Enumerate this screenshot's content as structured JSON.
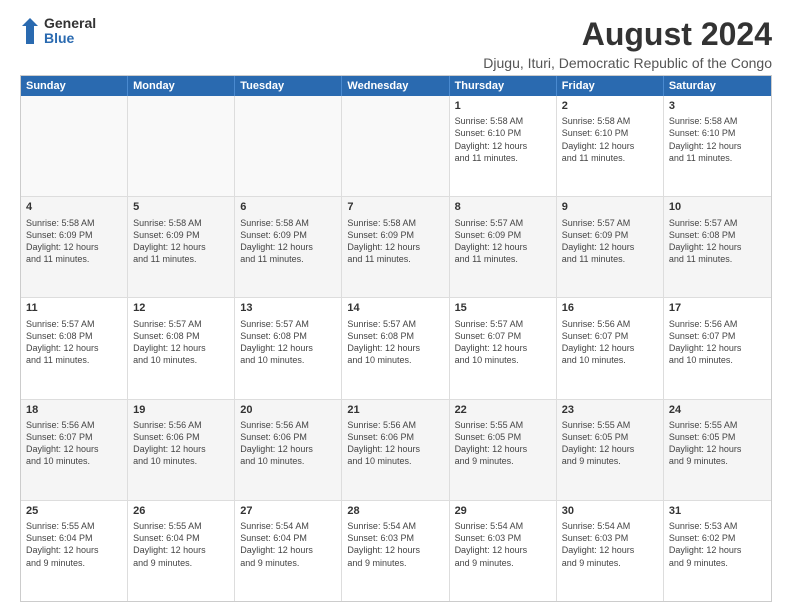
{
  "logo": {
    "general": "General",
    "blue": "Blue"
  },
  "title": "August 2024",
  "subtitle": "Djugu, Ituri, Democratic Republic of the Congo",
  "weekdays": [
    "Sunday",
    "Monday",
    "Tuesday",
    "Wednesday",
    "Thursday",
    "Friday",
    "Saturday"
  ],
  "weeks": [
    [
      {
        "day": "",
        "info": ""
      },
      {
        "day": "",
        "info": ""
      },
      {
        "day": "",
        "info": ""
      },
      {
        "day": "",
        "info": ""
      },
      {
        "day": "1",
        "info": "Sunrise: 5:58 AM\nSunset: 6:10 PM\nDaylight: 12 hours\nand 11 minutes."
      },
      {
        "day": "2",
        "info": "Sunrise: 5:58 AM\nSunset: 6:10 PM\nDaylight: 12 hours\nand 11 minutes."
      },
      {
        "day": "3",
        "info": "Sunrise: 5:58 AM\nSunset: 6:10 PM\nDaylight: 12 hours\nand 11 minutes."
      }
    ],
    [
      {
        "day": "4",
        "info": "Sunrise: 5:58 AM\nSunset: 6:09 PM\nDaylight: 12 hours\nand 11 minutes."
      },
      {
        "day": "5",
        "info": "Sunrise: 5:58 AM\nSunset: 6:09 PM\nDaylight: 12 hours\nand 11 minutes."
      },
      {
        "day": "6",
        "info": "Sunrise: 5:58 AM\nSunset: 6:09 PM\nDaylight: 12 hours\nand 11 minutes."
      },
      {
        "day": "7",
        "info": "Sunrise: 5:58 AM\nSunset: 6:09 PM\nDaylight: 12 hours\nand 11 minutes."
      },
      {
        "day": "8",
        "info": "Sunrise: 5:57 AM\nSunset: 6:09 PM\nDaylight: 12 hours\nand 11 minutes."
      },
      {
        "day": "9",
        "info": "Sunrise: 5:57 AM\nSunset: 6:09 PM\nDaylight: 12 hours\nand 11 minutes."
      },
      {
        "day": "10",
        "info": "Sunrise: 5:57 AM\nSunset: 6:08 PM\nDaylight: 12 hours\nand 11 minutes."
      }
    ],
    [
      {
        "day": "11",
        "info": "Sunrise: 5:57 AM\nSunset: 6:08 PM\nDaylight: 12 hours\nand 11 minutes."
      },
      {
        "day": "12",
        "info": "Sunrise: 5:57 AM\nSunset: 6:08 PM\nDaylight: 12 hours\nand 10 minutes."
      },
      {
        "day": "13",
        "info": "Sunrise: 5:57 AM\nSunset: 6:08 PM\nDaylight: 12 hours\nand 10 minutes."
      },
      {
        "day": "14",
        "info": "Sunrise: 5:57 AM\nSunset: 6:08 PM\nDaylight: 12 hours\nand 10 minutes."
      },
      {
        "day": "15",
        "info": "Sunrise: 5:57 AM\nSunset: 6:07 PM\nDaylight: 12 hours\nand 10 minutes."
      },
      {
        "day": "16",
        "info": "Sunrise: 5:56 AM\nSunset: 6:07 PM\nDaylight: 12 hours\nand 10 minutes."
      },
      {
        "day": "17",
        "info": "Sunrise: 5:56 AM\nSunset: 6:07 PM\nDaylight: 12 hours\nand 10 minutes."
      }
    ],
    [
      {
        "day": "18",
        "info": "Sunrise: 5:56 AM\nSunset: 6:07 PM\nDaylight: 12 hours\nand 10 minutes."
      },
      {
        "day": "19",
        "info": "Sunrise: 5:56 AM\nSunset: 6:06 PM\nDaylight: 12 hours\nand 10 minutes."
      },
      {
        "day": "20",
        "info": "Sunrise: 5:56 AM\nSunset: 6:06 PM\nDaylight: 12 hours\nand 10 minutes."
      },
      {
        "day": "21",
        "info": "Sunrise: 5:56 AM\nSunset: 6:06 PM\nDaylight: 12 hours\nand 10 minutes."
      },
      {
        "day": "22",
        "info": "Sunrise: 5:55 AM\nSunset: 6:05 PM\nDaylight: 12 hours\nand 9 minutes."
      },
      {
        "day": "23",
        "info": "Sunrise: 5:55 AM\nSunset: 6:05 PM\nDaylight: 12 hours\nand 9 minutes."
      },
      {
        "day": "24",
        "info": "Sunrise: 5:55 AM\nSunset: 6:05 PM\nDaylight: 12 hours\nand 9 minutes."
      }
    ],
    [
      {
        "day": "25",
        "info": "Sunrise: 5:55 AM\nSunset: 6:04 PM\nDaylight: 12 hours\nand 9 minutes."
      },
      {
        "day": "26",
        "info": "Sunrise: 5:55 AM\nSunset: 6:04 PM\nDaylight: 12 hours\nand 9 minutes."
      },
      {
        "day": "27",
        "info": "Sunrise: 5:54 AM\nSunset: 6:04 PM\nDaylight: 12 hours\nand 9 minutes."
      },
      {
        "day": "28",
        "info": "Sunrise: 5:54 AM\nSunset: 6:03 PM\nDaylight: 12 hours\nand 9 minutes."
      },
      {
        "day": "29",
        "info": "Sunrise: 5:54 AM\nSunset: 6:03 PM\nDaylight: 12 hours\nand 9 minutes."
      },
      {
        "day": "30",
        "info": "Sunrise: 5:54 AM\nSunset: 6:03 PM\nDaylight: 12 hours\nand 9 minutes."
      },
      {
        "day": "31",
        "info": "Sunrise: 5:53 AM\nSunset: 6:02 PM\nDaylight: 12 hours\nand 9 minutes."
      }
    ]
  ]
}
